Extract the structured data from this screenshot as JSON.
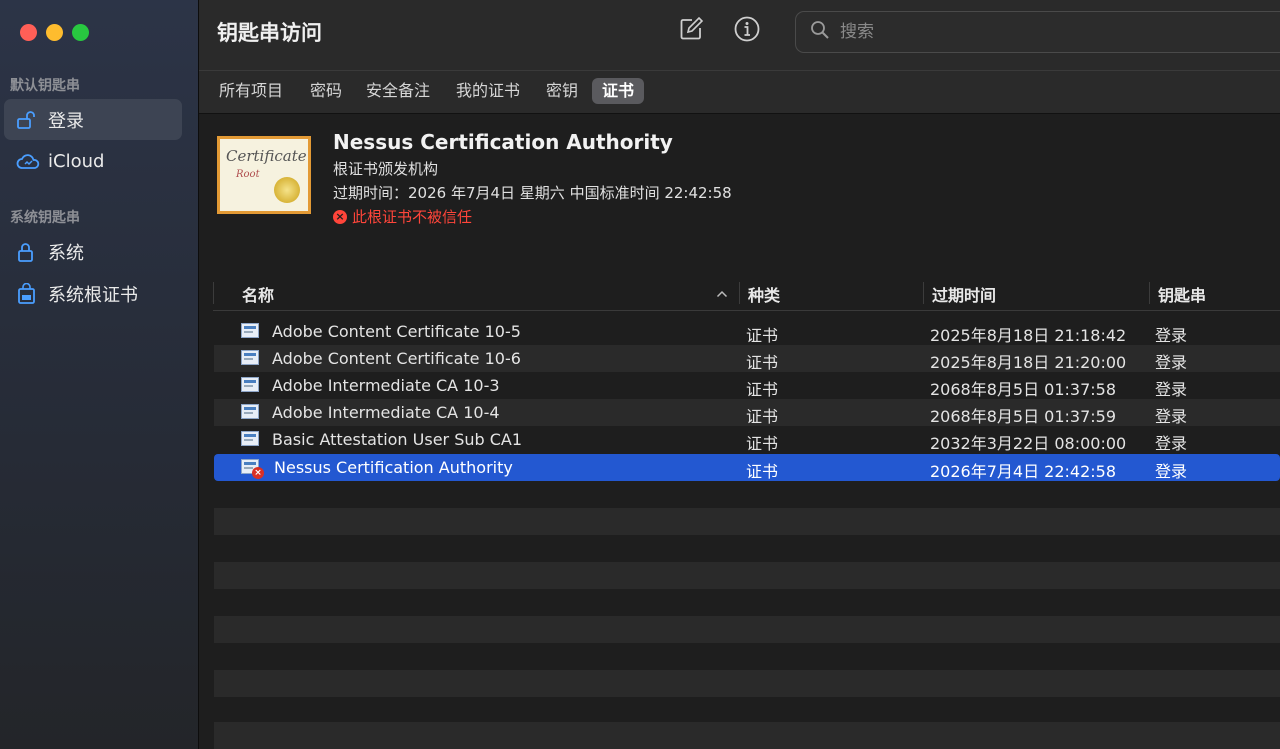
{
  "sidebar": {
    "default_section": "默认钥匙串",
    "system_section": "系统钥匙串",
    "items": [
      {
        "label": "登录",
        "icon": "unlocked-lock-icon"
      },
      {
        "label": "iCloud",
        "icon": "cloud-icon"
      },
      {
        "label": "系统",
        "icon": "lock-icon"
      },
      {
        "label": "系统根证书",
        "icon": "locked-cabinet-icon"
      }
    ]
  },
  "toolbar": {
    "title": "钥匙串访问",
    "search_placeholder": "搜索"
  },
  "tabs": [
    {
      "label": "所有项目"
    },
    {
      "label": "密码"
    },
    {
      "label": "安全备注"
    },
    {
      "label": "我的证书"
    },
    {
      "label": "密钥"
    },
    {
      "label": "证书"
    }
  ],
  "detail": {
    "cert_text": "Certificate",
    "cert_sub": "Root",
    "name": "Nessus Certification Authority",
    "kind": "根证书颁发机构",
    "expires": "过期时间：2026 年7月4日 星期六 中国标准时间 22:42:58",
    "trust": "此根证书不被信任"
  },
  "table": {
    "headers": {
      "name": "名称",
      "kind": "种类",
      "expires": "过期时间",
      "keychain": "钥匙串"
    },
    "rows": [
      {
        "name": "Adobe Content Certificate 10-5",
        "kind": "证书",
        "expires": "2025年8月18日 21:18:42",
        "keychain": "登录"
      },
      {
        "name": "Adobe Content Certificate 10-6",
        "kind": "证书",
        "expires": "2025年8月18日 21:20:00",
        "keychain": "登录"
      },
      {
        "name": "Adobe Intermediate CA 10-3",
        "kind": "证书",
        "expires": "2068年8月5日 01:37:58",
        "keychain": "登录"
      },
      {
        "name": "Adobe Intermediate CA 10-4",
        "kind": "证书",
        "expires": "2068年8月5日 01:37:59",
        "keychain": "登录"
      },
      {
        "name": "Basic Attestation User Sub CA1",
        "kind": "证书",
        "expires": "2032年3月22日 08:00:00",
        "keychain": "登录"
      },
      {
        "name": "Nessus Certification Authority",
        "kind": "证书",
        "expires": "2026年7月4日 22:42:58",
        "keychain": "登录"
      }
    ]
  },
  "colors": {
    "accent": "#2358d1",
    "error": "#ff453a",
    "sidebar_icon": "#4a9eff"
  }
}
